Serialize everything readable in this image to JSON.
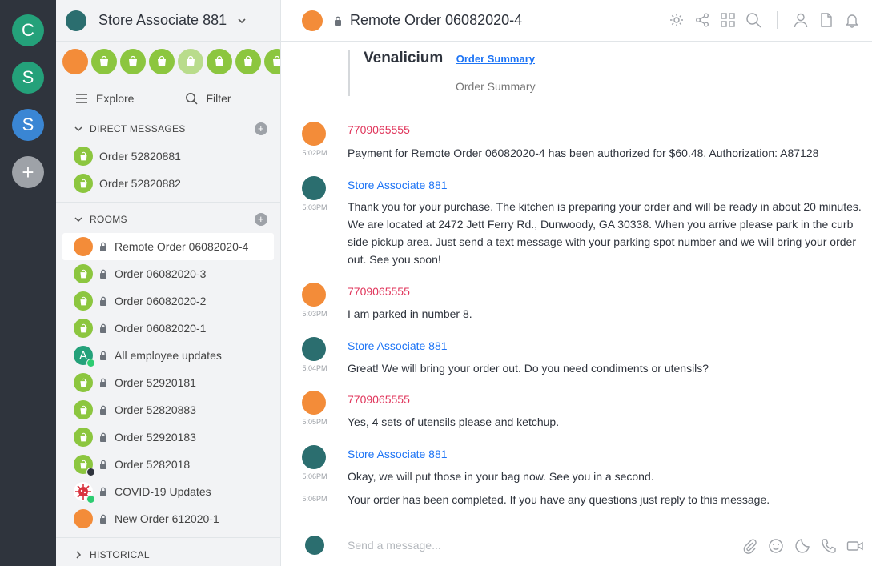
{
  "rail": {
    "servers": [
      {
        "letter": "C",
        "color": "#24a17a"
      },
      {
        "letter": "S",
        "color": "#24a17a"
      },
      {
        "letter": "S",
        "color": "#3a86d4"
      }
    ],
    "add_label": "+"
  },
  "sidebar": {
    "title": "Store Associate 881",
    "explore_label": "Explore",
    "filter_label": "Filter",
    "direct_messages": {
      "heading": "DIRECT MESSAGES",
      "items": [
        {
          "label": "Order 52820881"
        },
        {
          "label": "Order 52820882"
        }
      ]
    },
    "rooms": {
      "heading": "ROOMS",
      "items": [
        {
          "label": "Remote Order 06082020-4"
        },
        {
          "label": "Order 06082020-3"
        },
        {
          "label": "Order 06082020-2"
        },
        {
          "label": "Order 06082020-1"
        },
        {
          "label": "All employee updates"
        },
        {
          "label": "Order 52920181"
        },
        {
          "label": "Order 52820883"
        },
        {
          "label": "Order 52920183"
        },
        {
          "label": "Order 5282018"
        },
        {
          "label": "COVID-19 Updates"
        },
        {
          "label": "New Order 612020-1"
        }
      ]
    },
    "historical_heading": "HISTORICAL",
    "avatar_letter_all_employee": "A"
  },
  "main": {
    "room_title": "Remote Order 06082020-4",
    "quote": {
      "brand": "Venalicium",
      "link": "Order Summary",
      "subtitle": "Order Summary"
    },
    "messages": [
      {
        "author": "7709065555",
        "time": "5:02PM",
        "lines": [
          "Payment for Remote Order 06082020-4 has been authorized for $60.48.  Authorization: A87128"
        ]
      },
      {
        "author": "Store Associate 881",
        "time": "5:03PM",
        "lines": [
          "Thank you for your purchase.  The kitchen is preparing your order and will be ready in about 20 minutes.",
          "We are located at 2472 Jett Ferry Rd., Dunwoody, GA 30338.  When you arrive please park in the curb",
          "side pickup area.  Just send a text message with your parking spot number and we will bring your order",
          "out.  See you soon!"
        ]
      },
      {
        "author": "7709065555",
        "time": "5:03PM",
        "lines": [
          "I am parked in number 8."
        ]
      },
      {
        "author": "Store Associate 881",
        "time": "5:04PM",
        "lines": [
          "Great!  We will bring your order out.  Do you need condiments or utensils?"
        ]
      },
      {
        "author": "7709065555",
        "time": "5:05PM",
        "lines": [
          "Yes, 4 sets of utensils please and ketchup."
        ]
      },
      {
        "author": "Store Associate 881",
        "time": "5:06PM",
        "lines": [
          "Okay, we will put those in your bag now.  See you in a second."
        ]
      },
      {
        "author": "",
        "time": "5:06PM",
        "lines": [
          "Your order has been completed.  If you have any questions just reply to this message."
        ]
      }
    ],
    "composer_placeholder": "Send a message..."
  },
  "colors": {
    "rail_bg": "#2f343d",
    "sidebar_bg": "#f2f3f5",
    "accent_link": "#1d74f5",
    "phone_author": "#e0355b",
    "bag_green": "#8cc63f",
    "avatar_orange": "#f38c39",
    "avatar_teal": "#2b6e6f"
  }
}
